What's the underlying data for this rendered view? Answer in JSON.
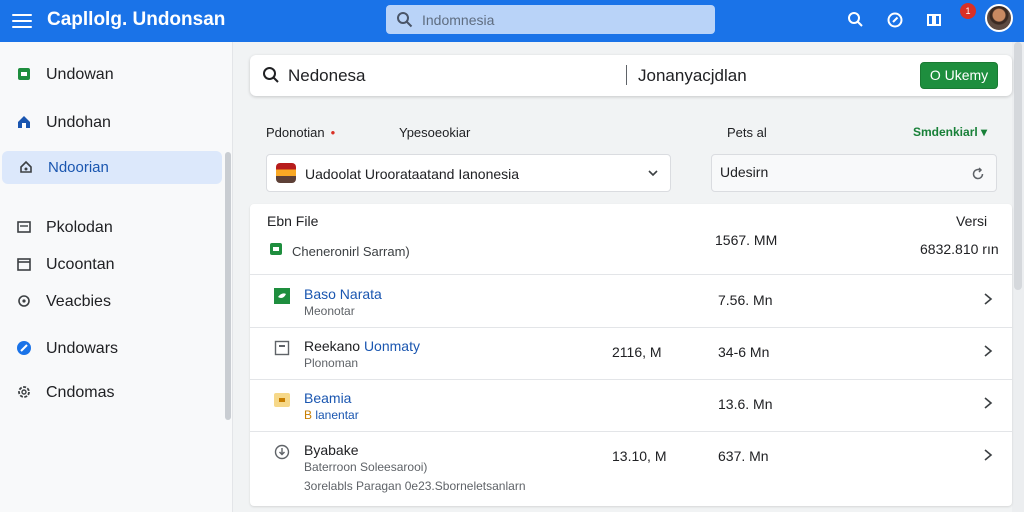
{
  "app": {
    "title": "Capllolg. Undonsan",
    "search_placeholder": "Indomnesia",
    "notification_count": "1",
    "accent_color": "#1a73e8"
  },
  "sidebar": {
    "items": [
      {
        "label": "Undowan",
        "icon": "green-square-icon"
      },
      {
        "label": "Undohan",
        "icon": "home-icon"
      },
      {
        "label": "Ndoorian",
        "icon": "house-outline-icon",
        "active": true
      },
      {
        "label": "Pkolodan",
        "icon": "card-icon"
      },
      {
        "label": "Ucoontan",
        "icon": "calendar-icon"
      },
      {
        "label": "Veacbies",
        "icon": "puzzle-icon"
      },
      {
        "label": "Undowars",
        "icon": "pencil-icon"
      },
      {
        "label": "Cndomas",
        "icon": "gear-icon"
      }
    ]
  },
  "search_card": {
    "query": "Nedonesa",
    "query_secondary": "Jonanyacjdlan",
    "primary_button": "O Ukemy"
  },
  "form": {
    "label_primary": "Pdonotian",
    "label_secondary": "Ypesoeokiar",
    "label_third": "Pets al",
    "dropdown_link": "Smdenkiarl",
    "select_value": "Uadoolat Uroorataatand Ianonesia",
    "input_value": "Udesirn"
  },
  "list": {
    "header": {
      "title": "Ebn File",
      "subtitle": "Cheneronirl Sarram)",
      "size": "1567. MM",
      "right_label": "Versi",
      "right_value": "6832.810 rın"
    },
    "rows": [
      {
        "title_plain": "",
        "title_link": "Baso Narata",
        "sub_badge": "",
        "sub_link": "",
        "sub": "Meonotar",
        "mid": "",
        "size": "7.56. Mn",
        "icon": "leaf-icon"
      },
      {
        "title_plain": "Reekano ",
        "title_link": "Uonmaty",
        "sub_badge": "",
        "sub_link": "",
        "sub": "Plonoman",
        "mid": "2116, M",
        "size": "34-6 Mn",
        "icon": "document-icon"
      },
      {
        "title_plain": "",
        "title_link": "Beamia",
        "sub_badge": "B ",
        "sub_link": "lanentar",
        "sub": "",
        "mid": "",
        "size": "13.6. Mn",
        "icon": "folder-icon"
      },
      {
        "title_plain": "Byabake",
        "title_link": "",
        "sub_badge": "",
        "sub_link": "",
        "sub": "Baterroon Soleesarooi)",
        "mid": "13.10, M",
        "size": "637. Mn",
        "icon": "download-icon",
        "footer": "3orelabls Paragan 0e23.Sborneletsanlarn"
      }
    ]
  }
}
